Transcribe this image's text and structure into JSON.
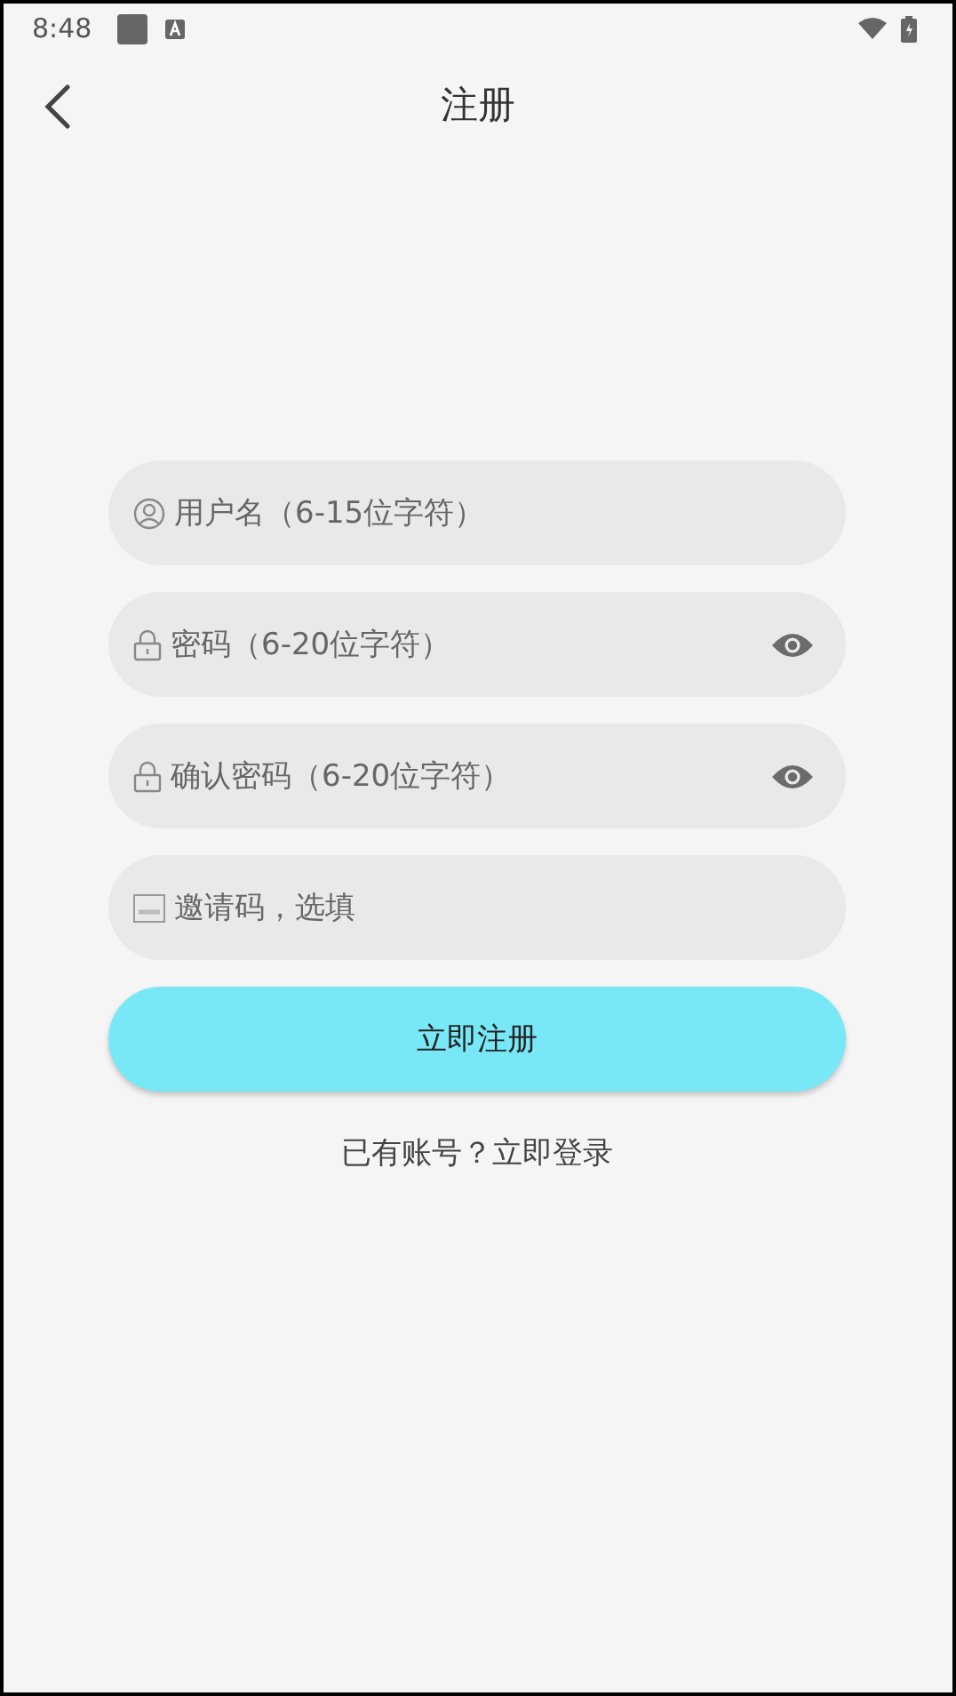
{
  "status_bar": {
    "time": "8:48"
  },
  "header": {
    "title": "注册"
  },
  "fields": [
    {
      "kind": "user",
      "placeholder": "用户名（6-15位字符）",
      "reveal_toggle": false
    },
    {
      "kind": "lock",
      "placeholder": "密码（6-20位字符）",
      "reveal_toggle": true
    },
    {
      "kind": "lock",
      "placeholder": "确认密码（6-20位字符）",
      "reveal_toggle": true
    },
    {
      "kind": "code",
      "placeholder": "邀请码，选填",
      "reveal_toggle": false
    }
  ],
  "submit_button": "立即注册",
  "login_link": "已有账号？立即登录"
}
